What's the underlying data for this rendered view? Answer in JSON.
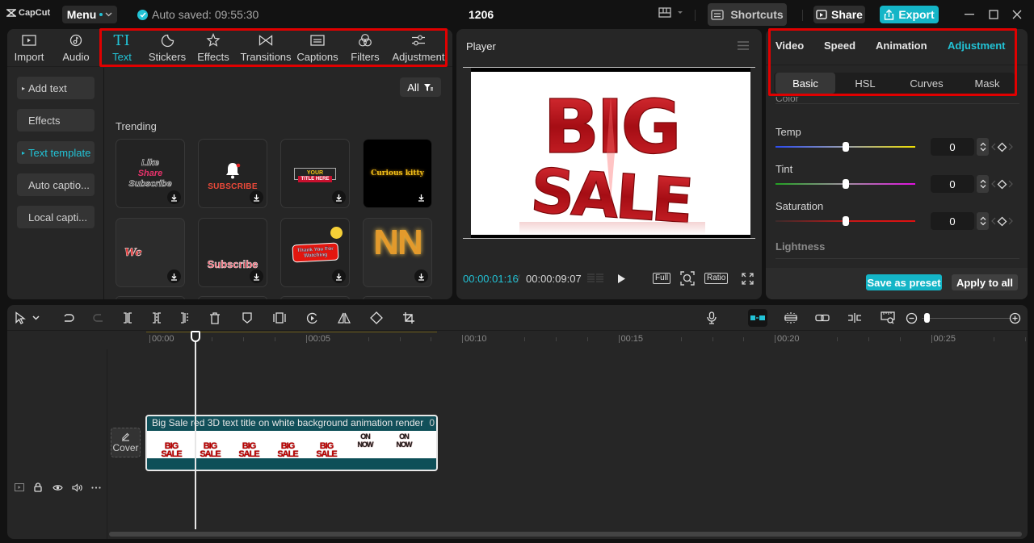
{
  "app": {
    "logo_text": "CapCut",
    "menu_label": "Menu",
    "autosave_text": "Auto saved: 09:55:30",
    "project_title": "1206",
    "shortcuts_label": "Shortcuts",
    "share_label": "Share",
    "export_label": "Export",
    "accent_color": "#22c3d6",
    "highlight_box_color": "#e00000"
  },
  "media": {
    "tabs": [
      {
        "label": "Import",
        "icon": "import-icon"
      },
      {
        "label": "Audio",
        "icon": "audio-icon"
      },
      {
        "label": "Text",
        "icon": "text-icon",
        "active": true
      },
      {
        "label": "Stickers",
        "icon": "sticker-icon"
      },
      {
        "label": "Effects",
        "icon": "effects-icon"
      },
      {
        "label": "Transitions",
        "icon": "transitions-icon"
      },
      {
        "label": "Captions",
        "icon": "captions-icon"
      },
      {
        "label": "Filters",
        "icon": "filters-icon"
      },
      {
        "label": "Adjustment",
        "icon": "adjustment-icon"
      }
    ],
    "sidebar": [
      {
        "label": "Add text",
        "arrow": true
      },
      {
        "label": "Effects"
      },
      {
        "label": "Text template",
        "arrow": true,
        "active": true
      },
      {
        "label": "Auto captio..."
      },
      {
        "label": "Local capti..."
      }
    ],
    "filter_label": "All",
    "section_title": "Trending",
    "templates": [
      {
        "lines": [
          "Like",
          "Share",
          "Subscribe"
        ]
      },
      {
        "lines": [
          "SUBSCRIBE"
        ]
      },
      {
        "lines": [
          "YOUR",
          "TITLE HERE"
        ]
      },
      {
        "lines": [
          "Curious kitty"
        ]
      },
      {
        "lines": [
          "We"
        ]
      },
      {
        "lines": [
          "Subscribe"
        ]
      },
      {
        "lines": [
          "Thank You For",
          "Watching"
        ]
      },
      {
        "lines": [
          "NN"
        ]
      }
    ]
  },
  "player": {
    "title": "Player",
    "preview_text": [
      "BIG",
      "SALE"
    ],
    "current_time": "00:00:01:16",
    "total_time": "00:00:09:07",
    "full_label": "Full",
    "ratio_label": "Ratio"
  },
  "inspector": {
    "tabs": [
      {
        "label": "Video"
      },
      {
        "label": "Speed"
      },
      {
        "label": "Animation"
      },
      {
        "label": "Adjustment",
        "active": true
      }
    ],
    "subtabs": [
      {
        "label": "Basic",
        "active": true
      },
      {
        "label": "HSL"
      },
      {
        "label": "Curves"
      },
      {
        "label": "Mask"
      }
    ],
    "section_label": "Color",
    "properties": [
      {
        "label": "Temp",
        "value": "0",
        "slider_fraction": 0.5
      },
      {
        "label": "Tint",
        "value": "0",
        "slider_fraction": 0.5
      },
      {
        "label": "Saturation",
        "value": "0",
        "slider_fraction": 0.5
      }
    ],
    "next_section": "Lightness",
    "save_preset_label": "Save as preset",
    "apply_all_label": "Apply to all"
  },
  "timeline": {
    "ruler_labels": [
      "00:00",
      "00:05",
      "00:10",
      "00:15",
      "00:20",
      "00:25"
    ],
    "cover_label": "Cover",
    "clip": {
      "title": "Big Sale red 3D text title on white background animation render",
      "duration_prefix": "0",
      "thumb_texts": [
        "BIG SALE",
        "BIG SALE",
        "BIG SALE",
        "BIG SALE",
        "BIG SALE",
        "ON NOW",
        "ON NOW"
      ]
    },
    "zoom_fraction": 0.05
  }
}
